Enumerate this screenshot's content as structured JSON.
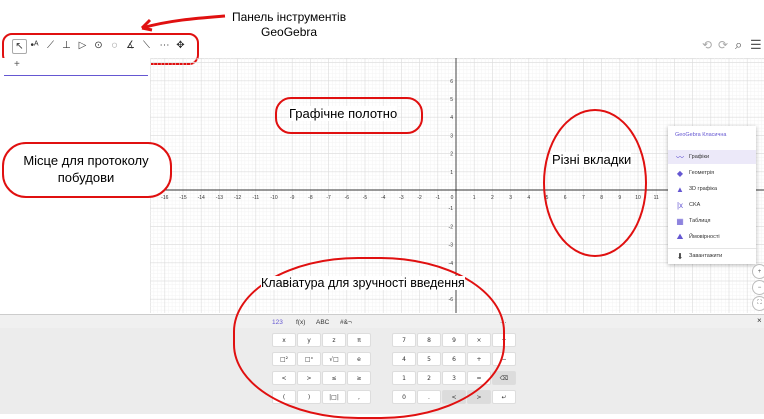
{
  "annotations": {
    "toolbar_label_line1": "Панель інструментів",
    "toolbar_label_line2": "GeoGebra",
    "graphics_label": "Графічне полотно",
    "protocol_label_line1": "Місце для протоколу",
    "protocol_label_line2": "побудови",
    "tabs_label": "Різні вкладки",
    "keyboard_label": "Клавіатура для зручності введення"
  },
  "algebra": {
    "add_label": "+"
  },
  "toolbar": {
    "tools": [
      "pointer-tool",
      "point-tool",
      "line-tool",
      "perpendicular-tool",
      "polygon-tool",
      "circle-tool",
      "circle-3pts-tool",
      "angle-tool",
      "reflect-tool",
      "slider-tool",
      "move-view-tool"
    ],
    "right": {
      "undo": "⟲",
      "redo": "⟳",
      "search": "⌕",
      "menu": "☰"
    }
  },
  "axes": {
    "x_labels": [
      "-16",
      "-15",
      "-14",
      "-13",
      "-12",
      "-11",
      "-10",
      "-9",
      "-8",
      "-7",
      "-6",
      "-5",
      "-4",
      "-3",
      "-2",
      "-1",
      "0",
      "1",
      "2",
      "3",
      "4",
      "5",
      "6",
      "7",
      "8",
      "9",
      "10",
      "11"
    ],
    "y_labels": [
      "6",
      "5",
      "4",
      "3",
      "2",
      "1",
      "-1",
      "-2",
      "-3",
      "-4",
      "-5",
      "-6"
    ]
  },
  "menu": {
    "title": "GeoGebra Класична",
    "items": [
      {
        "label": "Графіки",
        "icon": "graph-icon",
        "active": true
      },
      {
        "label": "Геометрія",
        "icon": "geometry-icon",
        "active": false
      },
      {
        "label": "3D графіка",
        "icon": "3d-icon",
        "active": false
      },
      {
        "label": "CKA",
        "icon": "cas-icon",
        "active": false
      },
      {
        "label": "Таблиця",
        "icon": "table-icon",
        "active": false
      },
      {
        "label": "Ймовірності",
        "icon": "probability-icon",
        "active": false
      },
      {
        "label": "Завантажити",
        "icon": "download-icon",
        "active": false
      }
    ]
  },
  "keyboard": {
    "tabs": [
      "123",
      "f(x)",
      "ABC",
      "#&¬"
    ],
    "more": "···",
    "close": "×",
    "rows": [
      [
        "x",
        "y",
        "z",
        "π",
        "7",
        "8",
        "9",
        "×",
        "÷"
      ],
      [
        "□²",
        "□ˣ",
        "√□",
        "e",
        "4",
        "5",
        "6",
        "+",
        "−"
      ],
      [
        "<",
        ">",
        "≤",
        "≥",
        "1",
        "2",
        "3",
        "=",
        "⌫"
      ],
      [
        "(",
        ")",
        "|□|",
        ",",
        "0",
        ".",
        "<",
        ">",
        "↵"
      ]
    ]
  },
  "colors": {
    "annotation_red": "#e01010",
    "accent": "#6557d2"
  }
}
